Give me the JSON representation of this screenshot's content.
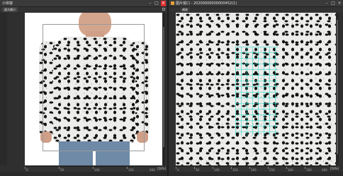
{
  "left_window": {
    "title": "小体窗",
    "toolbar_label": "放大缩小",
    "zoom": "[50%]",
    "ruler_ticks": [
      "0",
      "50",
      "100",
      "150",
      "200"
    ]
  },
  "right_window": {
    "title": "图片窗口 - 20200000000000452(1)",
    "toolbar_label": "缩放",
    "zoom": "[50%]",
    "ruler_ticks": [
      "0",
      "50",
      "100",
      "150",
      "200",
      "250",
      "300",
      "350",
      "400"
    ]
  },
  "colors": {
    "accent": "#d33333",
    "tile_overlay": "#28dcc8",
    "background": "#2b2b2b"
  },
  "icons": [
    "minimize-icon",
    "maximize-icon",
    "close-icon",
    "image-icon"
  ]
}
